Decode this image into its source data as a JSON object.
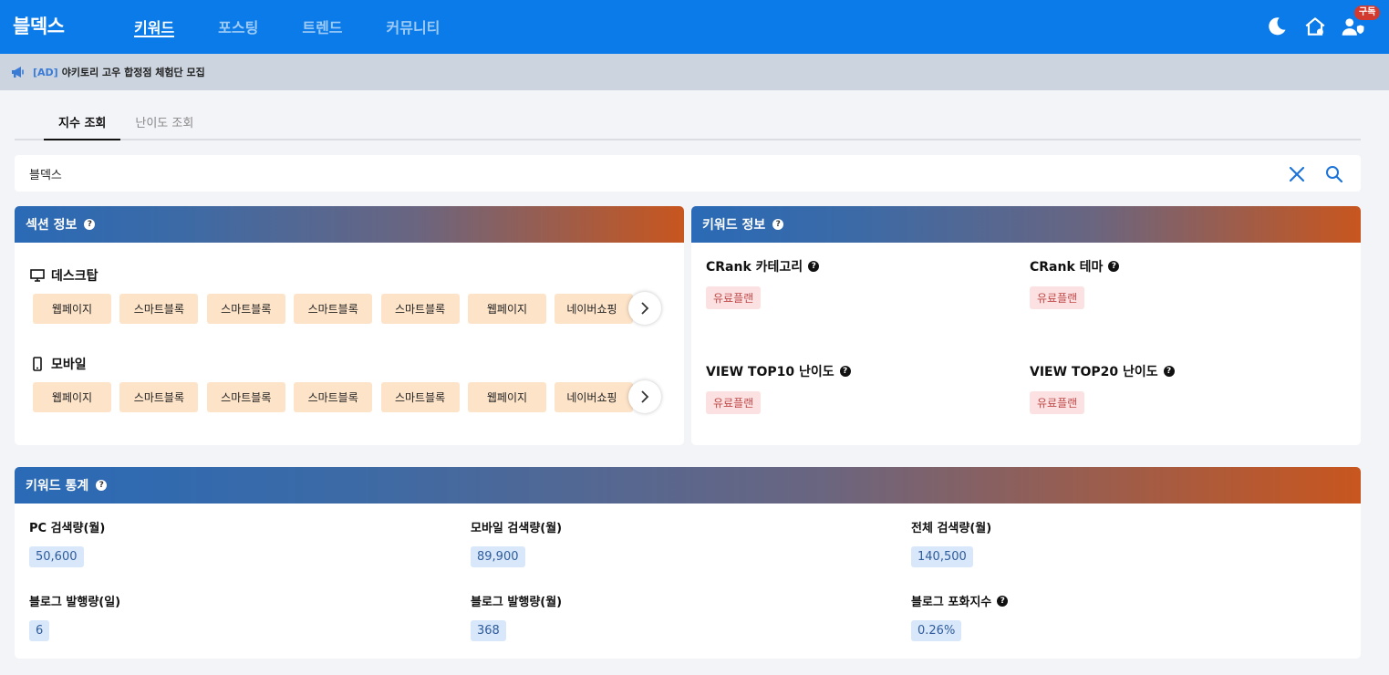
{
  "header": {
    "logo": "블덱스",
    "nav": [
      "키워드",
      "포스팅",
      "트렌드",
      "커뮤니티"
    ],
    "subscribe_badge": "구독",
    "bg_color": "#0a7be8"
  },
  "ad": {
    "tag": "[AD]",
    "text": "야키토리 고우 합정점 체험단 모집"
  },
  "tabs": [
    "지수 조회",
    "난이도 조회"
  ],
  "search": {
    "value": "블덱스"
  },
  "section_info": {
    "title": "섹션 정보",
    "desktop_label": "데스크탑",
    "mobile_label": "모바일",
    "desktop_chips": [
      "웹페이지",
      "스마트블록",
      "스마트블록",
      "스마트블록",
      "스마트블록",
      "웹페이지",
      "네이버쇼핑"
    ],
    "mobile_chips": [
      "웹페이지",
      "스마트블록",
      "스마트블록",
      "스마트블록",
      "스마트블록",
      "웹페이지",
      "네이버쇼핑"
    ]
  },
  "keyword_info": {
    "title": "키워드 정보",
    "items": [
      {
        "label": "CRank 카테고리",
        "value": "유료플랜"
      },
      {
        "label": "CRank 테마",
        "value": "유료플랜"
      },
      {
        "label": "VIEW TOP10 난이도",
        "value": "유료플랜"
      },
      {
        "label": "VIEW TOP20 난이도",
        "value": "유료플랜"
      }
    ]
  },
  "keyword_stats": {
    "title": "키워드 통계",
    "items": [
      {
        "label": "PC 검색량(월)",
        "value": "50,600"
      },
      {
        "label": "모바일 검색량(월)",
        "value": "89,900"
      },
      {
        "label": "전체 검색량(월)",
        "value": "140,500"
      },
      {
        "label": "블로그 발행량(일)",
        "value": "6"
      },
      {
        "label": "블로그 발행량(월)",
        "value": "368"
      },
      {
        "label": "블로그 포화지수",
        "value": "0.26%"
      }
    ]
  },
  "help_glyph": "?"
}
